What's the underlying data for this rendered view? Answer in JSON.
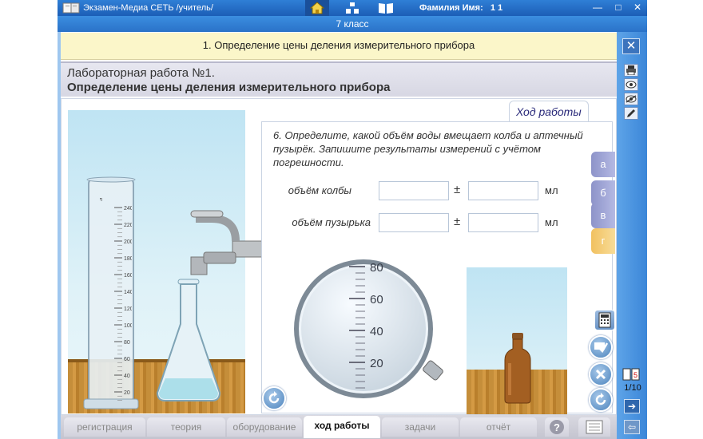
{
  "window": {
    "title": "Экзамен-Медиа СЕТЬ /учитель/",
    "user_label": "Фамилия Имя:",
    "user_value": "1 1",
    "minimize": "—",
    "maximize": "□",
    "close": "✕"
  },
  "class_bar": {
    "label": "7 класс"
  },
  "topic": {
    "title": "1. Определение цены деления измерительного прибора"
  },
  "lab": {
    "line1": "Лабораторная работа №1.",
    "line2": "Определение цены деления измерительного прибора"
  },
  "task": {
    "tab_label": "Ход работы",
    "instruction": "6. Определите, какой объём воды вмещает колба и аптечный пузырёк. Запишите результаты измерений с учётом погрешности.",
    "rows": [
      {
        "label": "объём колбы",
        "pm": "±",
        "unit": "мл",
        "value": "",
        "error": ""
      },
      {
        "label": "объём пузырька",
        "pm": "±",
        "unit": "мл",
        "value": "",
        "error": ""
      }
    ]
  },
  "cylinder": {
    "unit": "мл",
    "ticks": [
      "240",
      "220",
      "200",
      "180",
      "160",
      "140",
      "120",
      "100",
      "80",
      "60",
      "40",
      "20"
    ]
  },
  "magnifier": {
    "ticks": [
      "80",
      "60",
      "40",
      "20"
    ]
  },
  "side_tabs": [
    "а",
    "б",
    "в",
    "г"
  ],
  "bottom_tabs": [
    "регистрация",
    "теория",
    "оборудование",
    "ход работы",
    "задачи",
    "отчёт"
  ],
  "active_tab": "ход работы",
  "help_label": "?",
  "close_panel": "✕",
  "page_counter": "1/10",
  "colors": {
    "accent_blue": "#2f7fd6",
    "topic_bg": "#fbf6c9",
    "tab_active_bg": "#ffffff"
  }
}
